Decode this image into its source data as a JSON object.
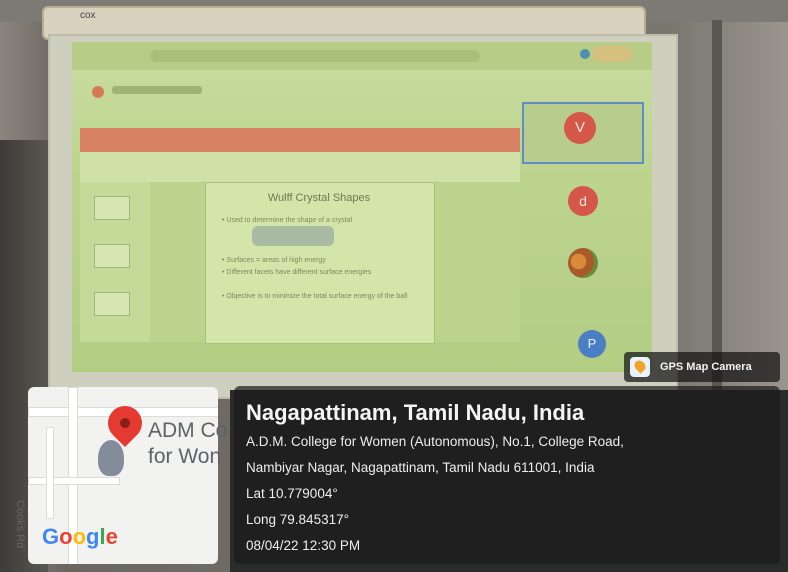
{
  "location": {
    "title": "Nagapattinam, Tamil Nadu, India",
    "address_line1": "A.D.M. College for Women (Autonomous), No.1, College Road,",
    "address_line2": "Nambiyar Nagar, Nagapattinam, Tamil Nadu 611001, India",
    "latitude": "Lat 10.779004°",
    "longitude": "Long 79.845317°",
    "datetime": "08/04/22 12:30 PM"
  },
  "app_badge": {
    "label": "GPS Map Camera"
  },
  "map": {
    "place_label_line1": "ADM Co",
    "place_label_line2": "for Won",
    "street_label": "Cooks Rd",
    "logo": [
      "G",
      "o",
      "o",
      "g",
      "l",
      "e"
    ]
  },
  "slide": {
    "title": "Wulff Crystal Shapes",
    "bullets": [
      "• Used to determine the shape of a crystal",
      "• Surfaces = areas of high energy",
      "• Different facets have different surface energies",
      "• Objective is to minimize the total surface energy of the ball"
    ]
  },
  "participants": [
    {
      "initial": "V",
      "color": "#d4574a"
    },
    {
      "initial": "d",
      "color": "#d4574a"
    },
    {
      "initial": "P",
      "color": "#4b7fc4"
    }
  ],
  "screen_box_label": "cox"
}
